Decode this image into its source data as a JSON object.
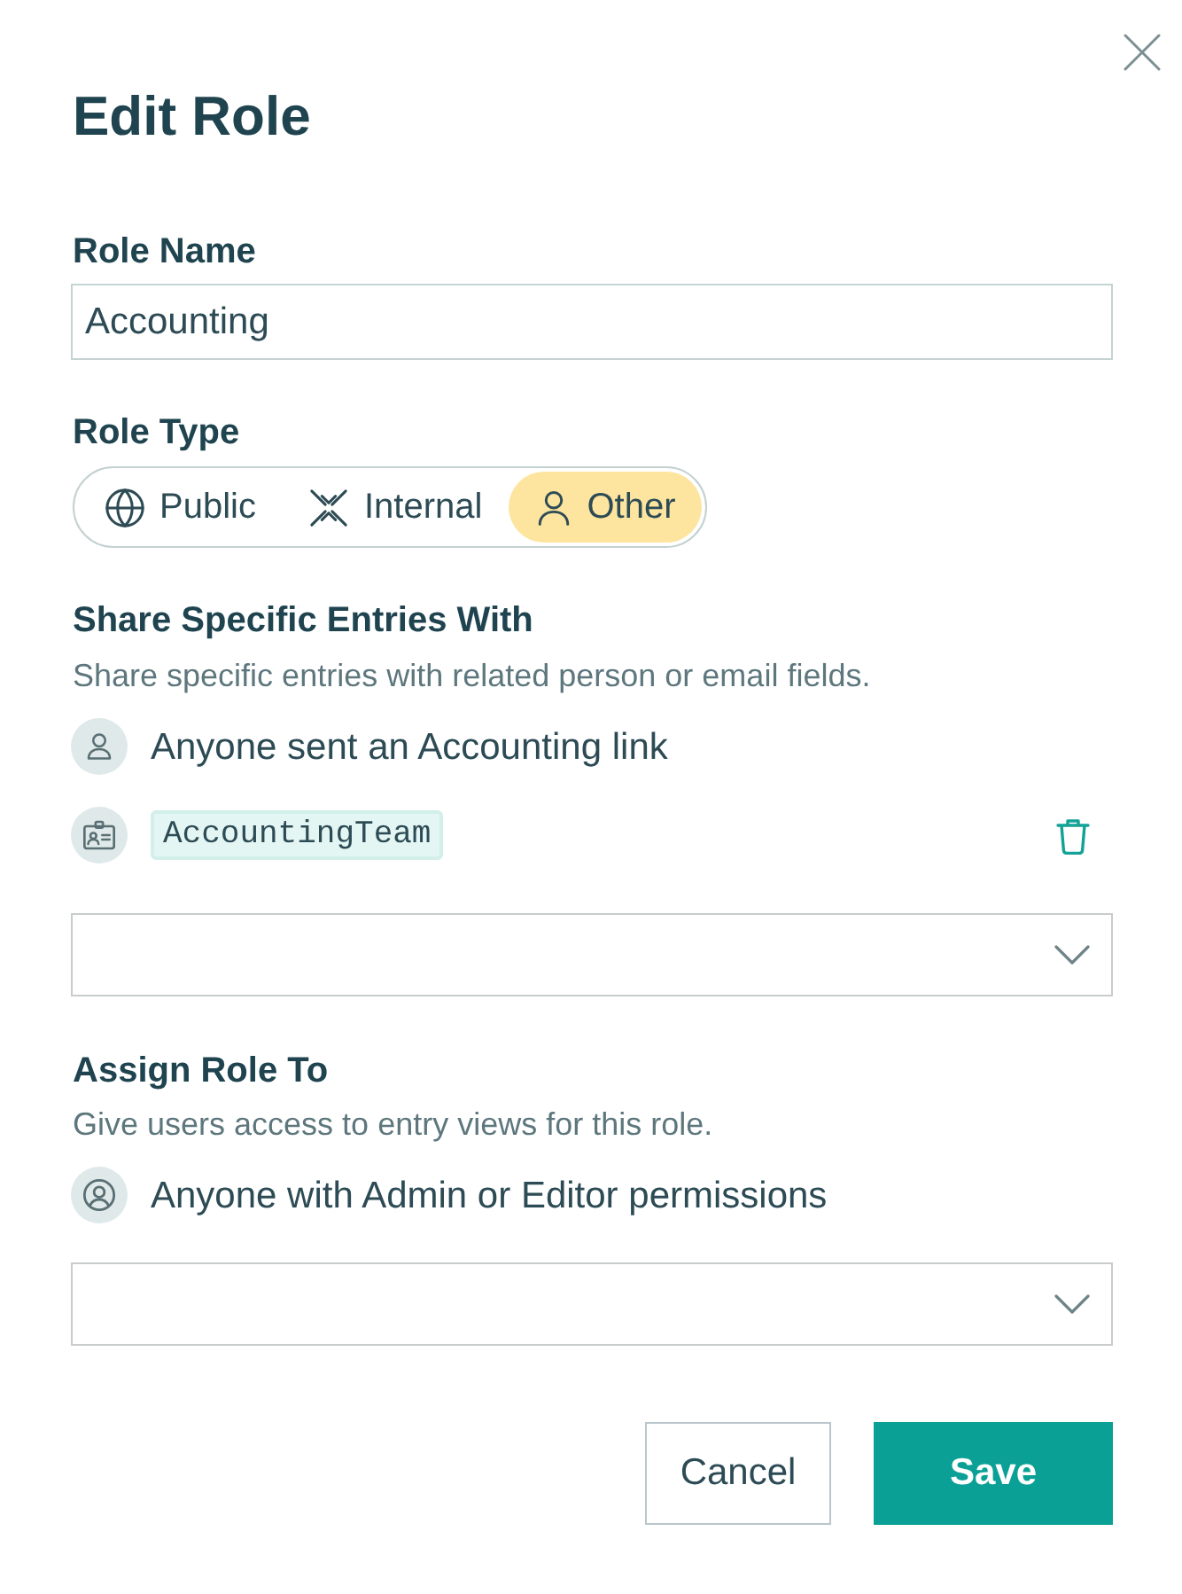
{
  "dialog": {
    "title": "Edit Role"
  },
  "role_name": {
    "label": "Role Name",
    "value": "Accounting"
  },
  "role_type": {
    "label": "Role Type",
    "options": [
      {
        "label": "Public",
        "kind": "globe",
        "selected": false
      },
      {
        "label": "Internal",
        "kind": "internal",
        "selected": false
      },
      {
        "label": "Other",
        "kind": "person",
        "selected": true
      }
    ]
  },
  "share": {
    "heading": "Share Specific Entries With",
    "description": "Share specific entries with related person or email fields.",
    "entries": [
      {
        "kind": "link",
        "text": "Anyone sent an Accounting link"
      },
      {
        "kind": "field",
        "text": "AccountingTeam"
      }
    ]
  },
  "assign": {
    "heading": "Assign Role To",
    "description": "Give users access to entry views for this role.",
    "entries": [
      {
        "kind": "permission",
        "text": "Anyone with Admin or Editor permissions"
      }
    ]
  },
  "buttons": [
    {
      "label": "Cancel",
      "kind": "secondary"
    },
    {
      "label": "Save",
      "kind": "primary"
    }
  ]
}
